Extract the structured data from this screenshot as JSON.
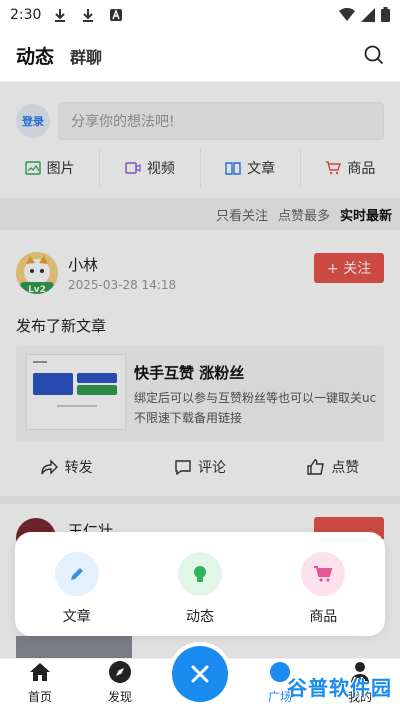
{
  "status_bar": {
    "time": "2:30"
  },
  "header": {
    "tab_active": "动态",
    "tab_other": "群聊"
  },
  "composer": {
    "login_label": "登录",
    "placeholder": "分享你的想法吧!",
    "types": [
      {
        "label": "图片",
        "icon": "image-icon",
        "color": "#3aa35b"
      },
      {
        "label": "视频",
        "icon": "video-icon",
        "color": "#8a5cd6"
      },
      {
        "label": "文章",
        "icon": "book-icon",
        "color": "#2b7de9"
      },
      {
        "label": "商品",
        "icon": "cart-icon",
        "color": "#e8554b"
      }
    ]
  },
  "filters": [
    "只看关注",
    "点赞最多",
    "实时最新"
  ],
  "post": {
    "author": "小林",
    "time": "2025-03-28 14:18",
    "level": "Lv2",
    "follow": "+ 关注",
    "text": "发布了新文章",
    "article": {
      "title": "快手互赞 涨粉丝",
      "desc": "绑定后可以参与互赞粉丝等也可以一键取关uc不限速下载备用链接"
    },
    "actions": [
      "转发",
      "评论",
      "点赞"
    ]
  },
  "post2": {
    "author": "王仁壮"
  },
  "popup": [
    {
      "label": "文章",
      "icon": "pencil-icon",
      "bg": "#e3f0fd",
      "color": "#3a8ee6"
    },
    {
      "label": "动态",
      "icon": "bulb-icon",
      "bg": "#e2f6e8",
      "color": "#2fb35b"
    },
    {
      "label": "商品",
      "icon": "cart-icon",
      "bg": "#fde2ee",
      "color": "#e8559a"
    }
  ],
  "nav": {
    "home": "首页",
    "discover": "发现",
    "square": "广场",
    "mine": "我的"
  },
  "watermark": "谷普软件园",
  "colors": {
    "accent": "#1a8cf0",
    "follow": "#e8554b"
  }
}
